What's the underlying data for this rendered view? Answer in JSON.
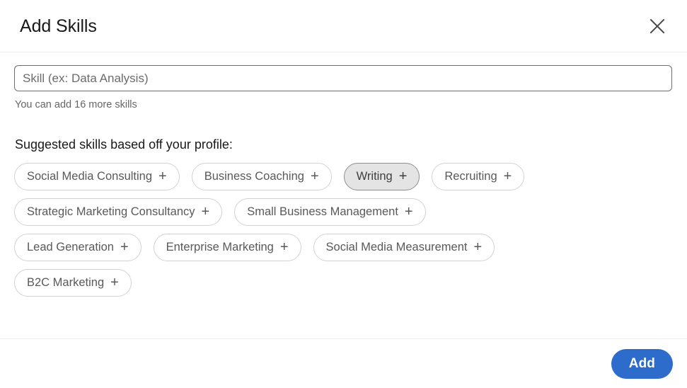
{
  "dialog": {
    "title": "Add Skills",
    "close_icon": "close-icon"
  },
  "form": {
    "skill_input_value": "",
    "skill_input_placeholder": "Skill (ex: Data Analysis)",
    "helper_text": "You can add 16 more skills"
  },
  "suggested": {
    "label": "Suggested skills based off your profile:",
    "plus_glyph": "+",
    "rows": [
      [
        {
          "label": "Social Media Consulting",
          "active": false
        },
        {
          "label": "Business Coaching",
          "active": false
        },
        {
          "label": "Writing",
          "active": true
        },
        {
          "label": "Recruiting",
          "active": false
        }
      ],
      [
        {
          "label": "Strategic Marketing Consultancy",
          "active": false
        },
        {
          "label": "Small Business Management",
          "active": false
        }
      ],
      [
        {
          "label": "Lead Generation",
          "active": false
        },
        {
          "label": "Enterprise Marketing",
          "active": false
        },
        {
          "label": "Social Media Measurement",
          "active": false
        }
      ],
      [
        {
          "label": "B2C Marketing",
          "active": false
        }
      ]
    ]
  },
  "footer": {
    "add_label": "Add"
  },
  "colors": {
    "accent": "#2d6cca",
    "chip_border": "#d2d2d2",
    "chip_active_bg": "#e4e4e4",
    "chip_active_border": "#8d8d8d",
    "text_primary": "#191919",
    "text_secondary": "#666666",
    "divider": "#ededed"
  }
}
